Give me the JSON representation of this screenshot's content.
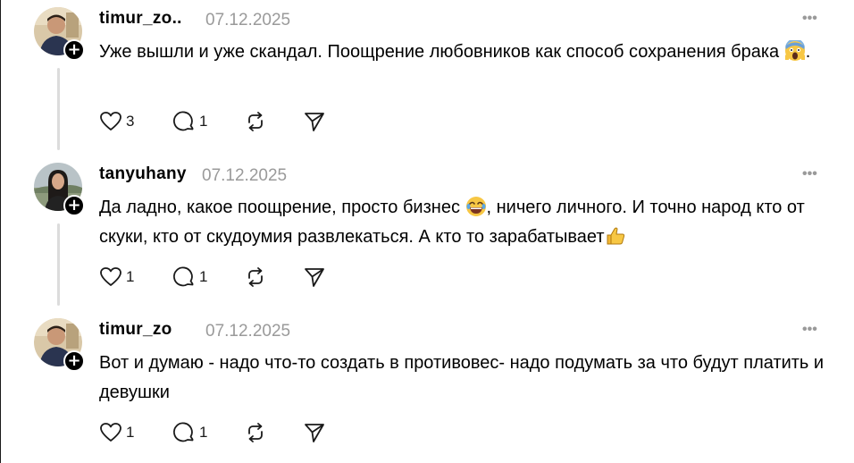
{
  "posts": [
    {
      "username": "timur_zo..",
      "date": "07.12.2025",
      "more_icon": "more-horizontal-icon",
      "text_main": "Уже вышли и уже скандал. Поощрение любовников как способ сохранения брака ",
      "text_tail": ".",
      "emoji": "screaming-face-emoji",
      "likes": "3",
      "replies": "1"
    },
    {
      "username": "tanyuhany",
      "date": "07.12.2025",
      "more_icon": "more-horizontal-icon",
      "text_main": "Да ладно, какое поощрение, просто бизнес ",
      "text_mid": ", ничего личного. И точно народ кто от скуки, кто от скудоумия развлекаться. А кто то зарабатывает",
      "emoji1": "tears-of-joy-emoji",
      "emoji2": "thumbs-up-emoji",
      "likes": "1",
      "replies": "1"
    },
    {
      "username": "timur_zo",
      "date": "07.12.2025",
      "more_icon": "more-horizontal-icon",
      "text_main": "Вот и думаю - надо что-то создать в противовес- надо подумать за что будут платить и девушки",
      "likes": "1",
      "replies": "1"
    }
  ],
  "icons": {
    "like": "heart-icon",
    "reply": "comment-icon",
    "repost": "repost-icon",
    "share": "send-icon",
    "follow": "plus-icon"
  },
  "colors": {
    "text": "#000000",
    "muted": "#9a9a9a",
    "thread_line": "#dcdcdc"
  }
}
